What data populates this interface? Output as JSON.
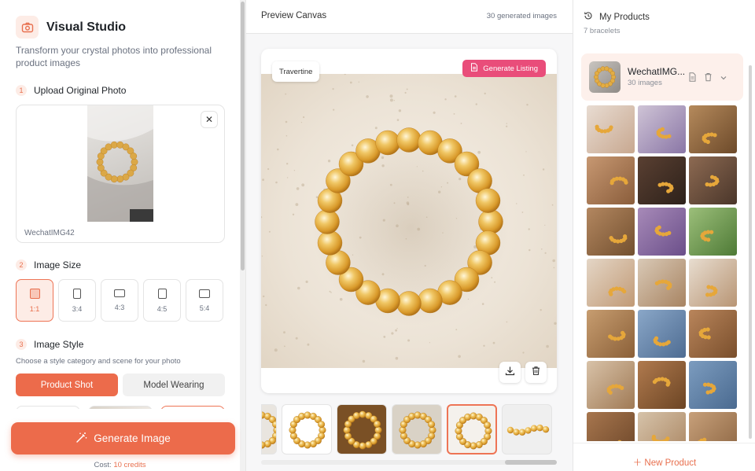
{
  "left": {
    "brand_title": "Visual Studio",
    "brand_subtitle": "Transform your crystal photos into professional product images",
    "step1": {
      "num": "1",
      "label": "Upload Original Photo"
    },
    "upload": {
      "filename": "WechatIMG42",
      "close_glyph": "✕"
    },
    "step2": {
      "num": "2",
      "label": "Image Size"
    },
    "sizes": [
      {
        "label": "1:1",
        "active": true
      },
      {
        "label": "3:4",
        "active": false
      },
      {
        "label": "4:3",
        "active": false
      },
      {
        "label": "4:5",
        "active": false
      },
      {
        "label": "5:4",
        "active": false
      }
    ],
    "step3": {
      "num": "3",
      "label": "Image Style"
    },
    "style_note": "Choose a style category and scene for your photo",
    "style_tabs": {
      "product_shot": "Product Shot",
      "model_wearing": "Model Wearing",
      "active": "Product Shot"
    },
    "generate": {
      "label": "Generate Image",
      "cost_prefix": "Cost:",
      "cost_value": "10 credits"
    }
  },
  "middle": {
    "title": "Preview Canvas",
    "count": "30 generated images",
    "scene_tag": "Travertine",
    "listing_button": "Generate Listing",
    "strip_active_index": 4
  },
  "right": {
    "title": "My Products",
    "subtitle": "7 bracelets",
    "product": {
      "name": "WechatIMG...",
      "count": "30 images"
    },
    "new_product": "New Product"
  },
  "colors": {
    "accent": "#ec6b4b",
    "accent_soft": "#fdece6",
    "listing_pink": "#e94d7a",
    "citrine": "#e6a73a"
  },
  "icons": [
    "camera-icon",
    "close-icon",
    "magic-wand-icon",
    "document-icon",
    "download-icon",
    "trash-icon",
    "history-icon",
    "chevron-down-icon",
    "plus-icon"
  ]
}
